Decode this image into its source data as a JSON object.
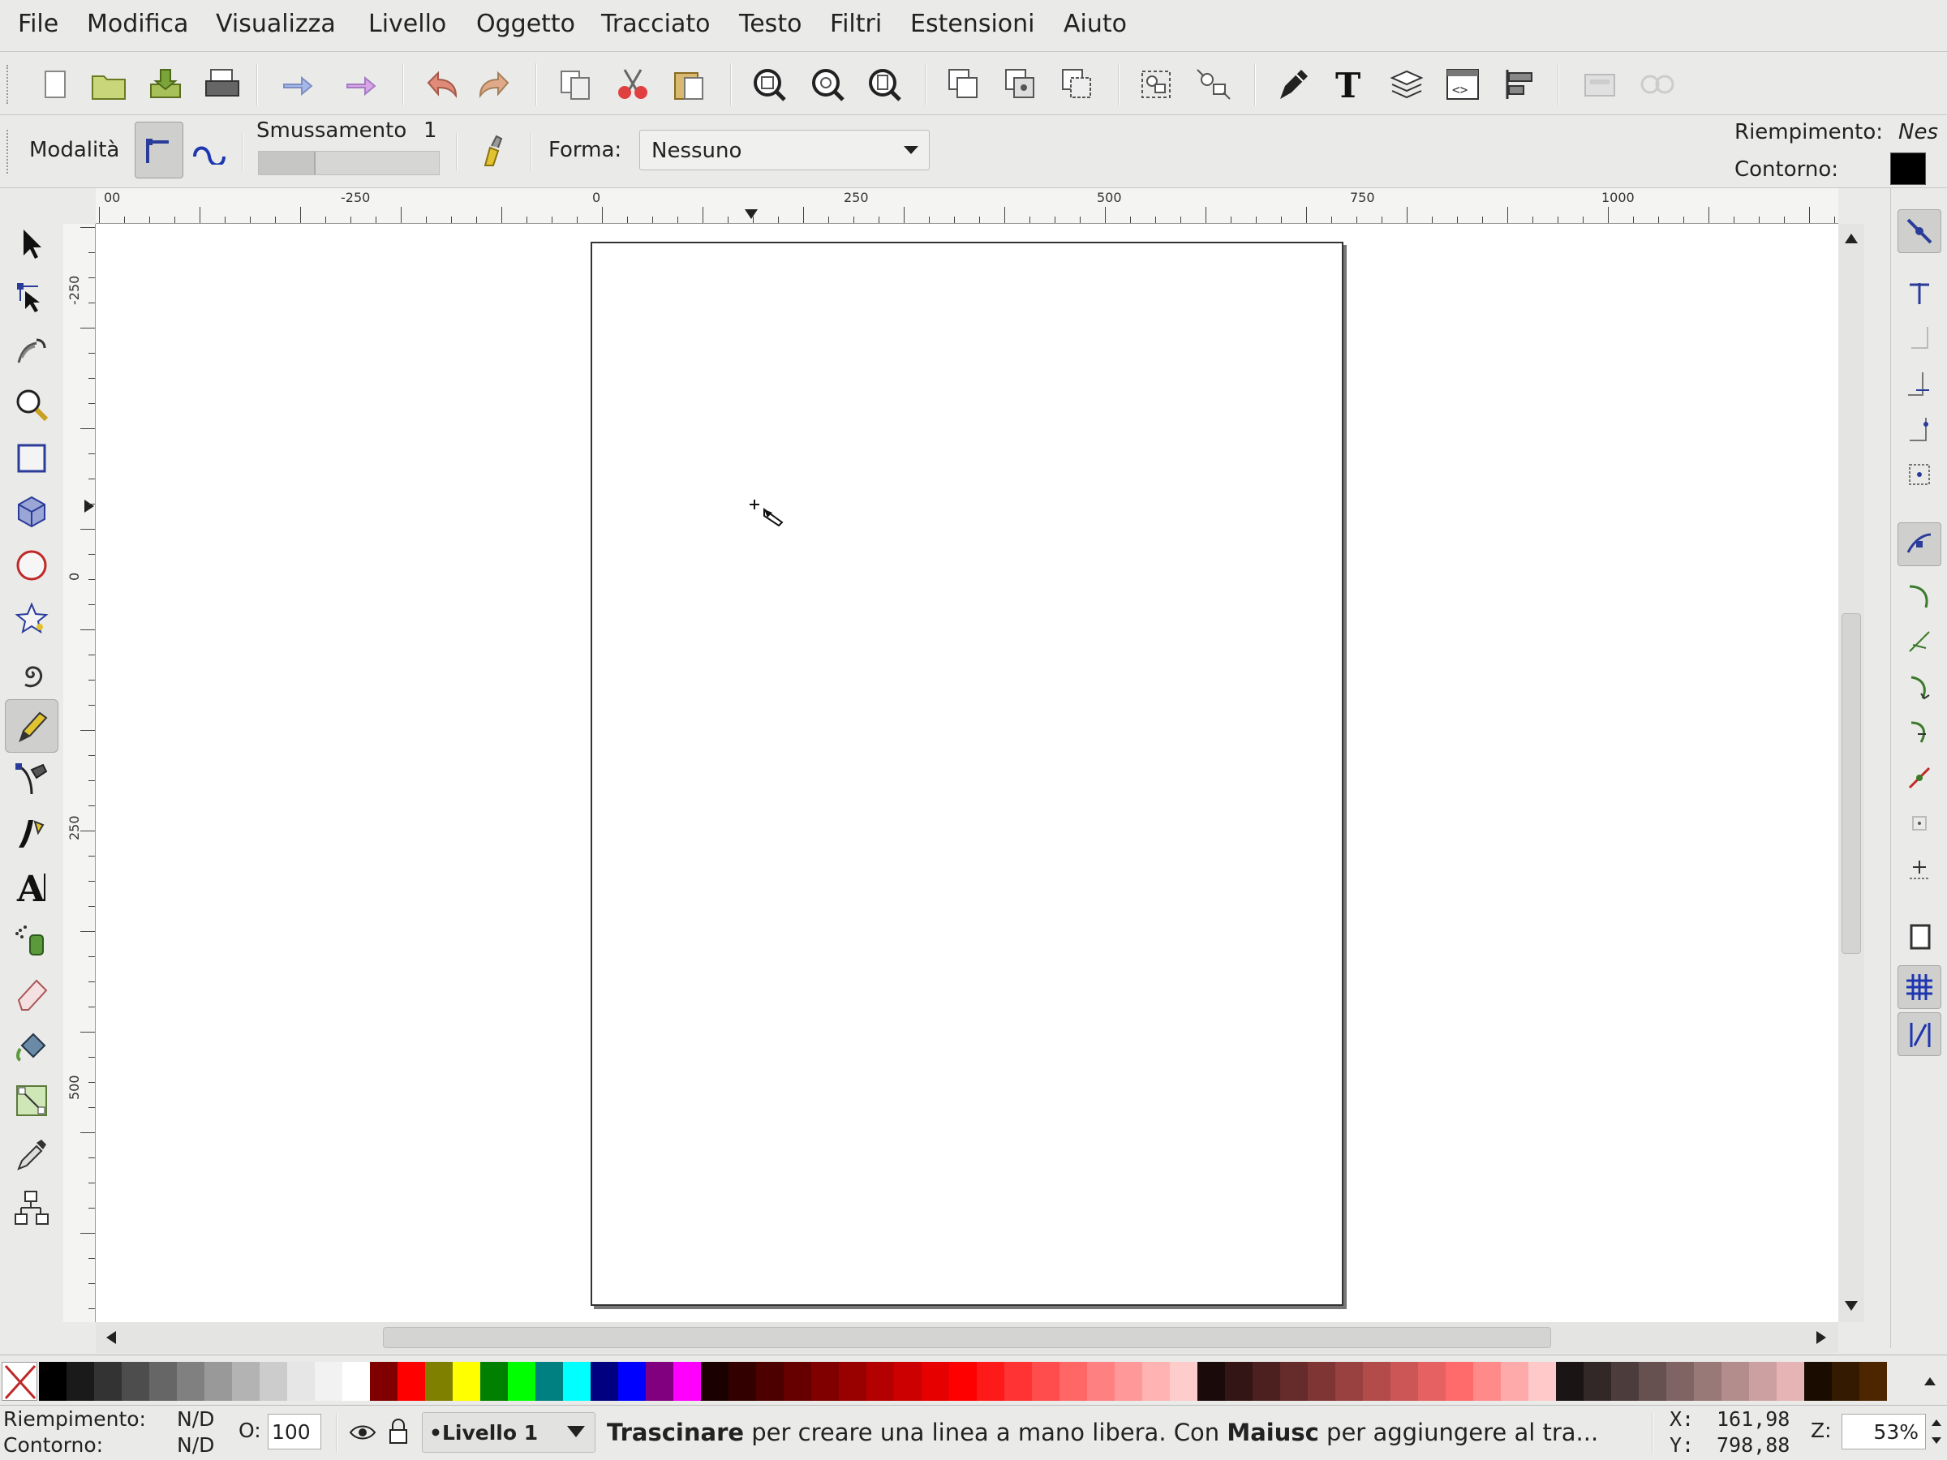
{
  "menubar": {
    "items": [
      {
        "label": "File"
      },
      {
        "label": "Modifica"
      },
      {
        "label": "Visualizza"
      },
      {
        "label": "Livello"
      },
      {
        "label": "Oggetto"
      },
      {
        "label": "Tracciato"
      },
      {
        "label": "Testo"
      },
      {
        "label": "Filtri"
      },
      {
        "label": "Estensioni"
      },
      {
        "label": "Aiuto"
      }
    ]
  },
  "commands": {
    "icons": [
      "new-document-icon",
      "open-icon",
      "save-icon",
      "print-icon",
      "import-icon",
      "export-icon",
      "undo-icon",
      "redo-icon",
      "copy-icon",
      "cut-icon",
      "paste-icon",
      "zoom-selection-icon",
      "zoom-drawing-icon",
      "zoom-page-icon",
      "duplicate-icon",
      "clone-icon",
      "unlink-clone-icon",
      "group-icon",
      "ungroup-icon",
      "fill-stroke-icon",
      "text-font-icon",
      "layers-icon",
      "xml-editor-icon",
      "align-icon",
      "preferences-icon",
      "document-properties-icon"
    ]
  },
  "tool_controls": {
    "mode_label": "Modalità",
    "smoothing_label": "Smussamento",
    "smoothing_value": "1",
    "shape_label": "Forma:",
    "shape_value": "Nessuno",
    "fill_label": "Riempimento:",
    "fill_value": "Nes",
    "stroke_label": "Contorno:",
    "stroke_color": "#000000"
  },
  "rulers": {
    "top_labels": [
      "00",
      "-250",
      "0",
      "250",
      "500",
      "750",
      "1000"
    ],
    "left_labels": [
      "-250",
      "0",
      "250",
      "500"
    ]
  },
  "toolbox": {
    "tools": [
      "selector-icon",
      "node-icon",
      "tweak-icon",
      "zoom-icon",
      "rectangle-icon",
      "3dbox-icon",
      "ellipse-icon",
      "star-icon",
      "spiral-icon",
      "pencil-icon",
      "pen-icon",
      "calligraphy-icon",
      "text-icon",
      "spray-icon",
      "eraser-icon",
      "paint-bucket-icon",
      "gradient-icon",
      "dropper-icon",
      "connector-icon"
    ],
    "active": "pencil-icon"
  },
  "palette": {
    "colors": [
      "#000000",
      "#1a1a1a",
      "#333333",
      "#4d4d4d",
      "#666666",
      "#808080",
      "#999999",
      "#b3b3b3",
      "#cccccc",
      "#e6e6e6",
      "#f2f2f2",
      "#ffffff",
      "#800000",
      "#ff0000",
      "#808000",
      "#ffff00",
      "#008000",
      "#00ff00",
      "#008080",
      "#00ffff",
      "#000080",
      "#0000ff",
      "#800080",
      "#ff00ff",
      "#1a0000",
      "#330000",
      "#4d0000",
      "#660000",
      "#800000",
      "#990000",
      "#b30000",
      "#cc0000",
      "#e60000",
      "#ff0000",
      "#ff1a1a",
      "#ff3333",
      "#ff4d4d",
      "#ff6666",
      "#ff8080",
      "#ff9999",
      "#ffb3b3",
      "#ffcccc",
      "#1a0a0a",
      "#331515",
      "#4d2020",
      "#662b2b",
      "#803535",
      "#994040",
      "#b34b4b",
      "#cc5656",
      "#e66161",
      "#ff6b6b",
      "#ff8a8a",
      "#ffaaaa",
      "#ffc9c9",
      "#1a1414",
      "#332828",
      "#4d3c3c",
      "#665050",
      "#806464",
      "#997878",
      "#b38c8c",
      "#cca0a0",
      "#e6b4b4",
      "#1a0d00",
      "#331a00",
      "#4d2600"
    ]
  },
  "status": {
    "fill_label": "Riempimento:",
    "fill_value": "N/D",
    "stroke_label": "Contorno:",
    "stroke_value": "N/D",
    "opacity_label": "O:",
    "opacity_value": "100",
    "layer_name": "•Livello 1",
    "message_bold1": "Trascinare",
    "message_rest1": " per creare una linea a mano libera. Con ",
    "message_bold2": "Maiusc",
    "message_rest2": " per aggiungere al tra...",
    "x_label": "X:",
    "x_value": "161,98",
    "y_label": "Y:",
    "y_value": "798,88",
    "zoom_label": "Z:",
    "zoom_value": "53%"
  }
}
